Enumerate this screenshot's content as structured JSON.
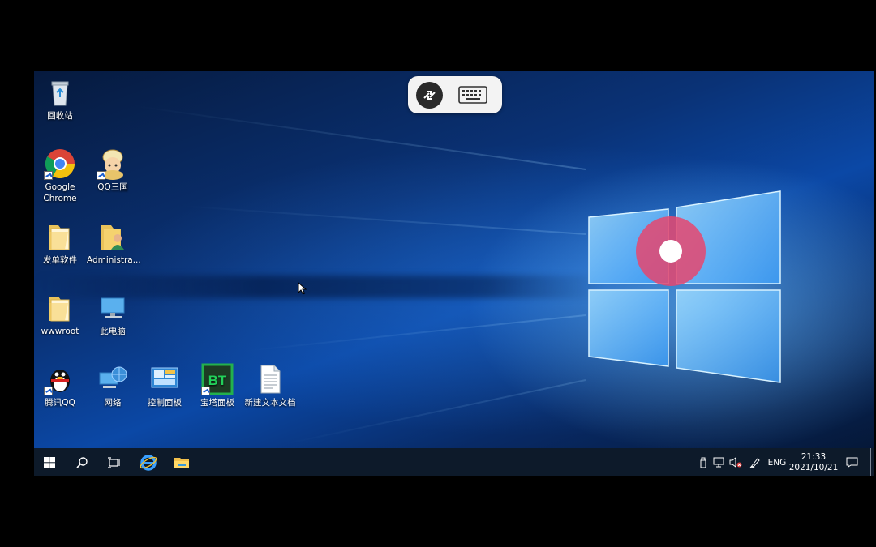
{
  "desktop_icons": [
    {
      "label": "回收站",
      "icon": "recycle-bin-icon"
    },
    {
      "label": "Google\nChrome",
      "icon": "chrome-icon"
    },
    {
      "label": "QQ三国",
      "icon": "qq-sanguo-icon"
    },
    {
      "label": "发单软件",
      "icon": "folder-icon"
    },
    {
      "label": "Administra...",
      "icon": "user-folder-icon"
    },
    {
      "label": "wwwroot",
      "icon": "folder-icon"
    },
    {
      "label": "此电脑",
      "icon": "computer-icon"
    },
    {
      "label": "腾讯QQ",
      "icon": "qq-penguin-icon"
    },
    {
      "label": "网络",
      "icon": "network-icon"
    },
    {
      "label": "控制面板",
      "icon": "control-panel-icon"
    },
    {
      "label": "宝塔面板",
      "icon": "bt-panel-icon"
    },
    {
      "label": "新建文本文档",
      "icon": "text-document-icon"
    }
  ],
  "bt_icon_text": "BT",
  "taskbar": {
    "language": "ENG",
    "time": "21:33",
    "date": "2021/10/21"
  },
  "colors": {
    "taskbar_bg": "#0d1a2a",
    "touch_indicator": "#e6466e",
    "desktop_blue": "#0b48a6"
  }
}
